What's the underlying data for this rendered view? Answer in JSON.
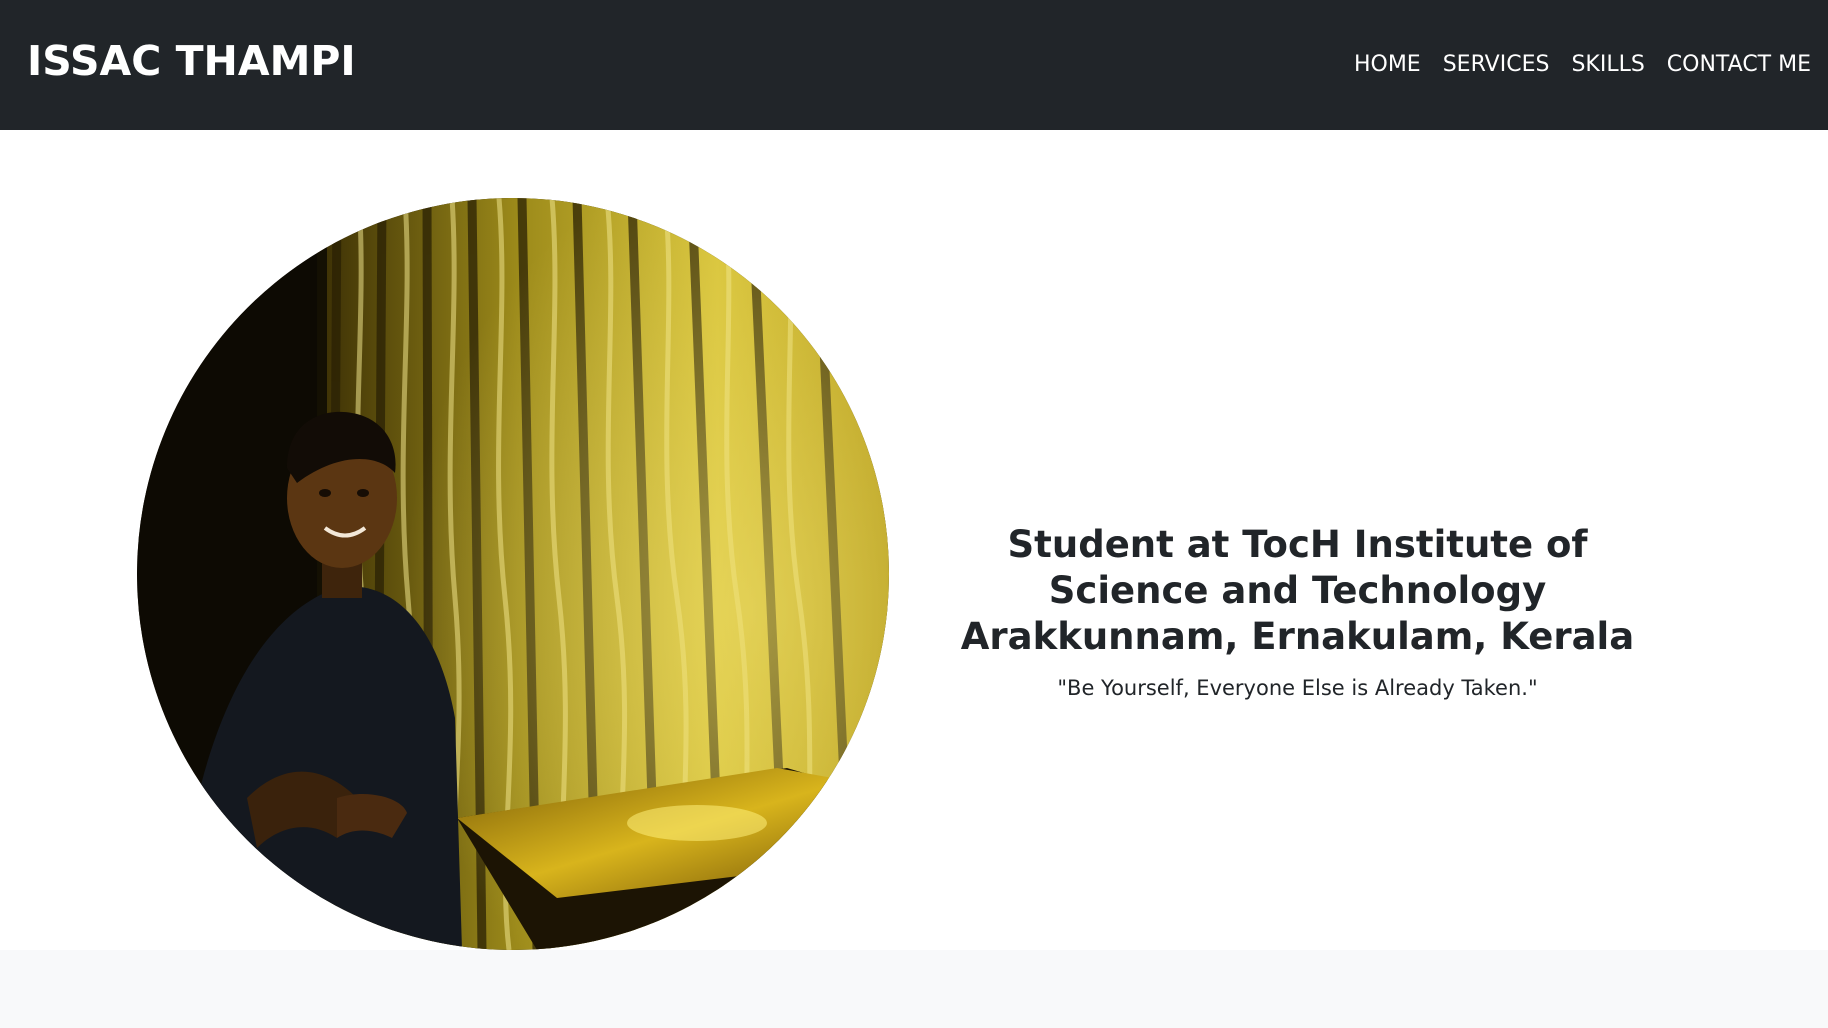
{
  "navbar": {
    "brand": "ISSAC THAMPI",
    "links": [
      "HOME",
      "SERVICES",
      "SKILLS",
      "CONTACT ME"
    ]
  },
  "hero": {
    "photo_icon": "profile-photo",
    "heading_line1": "Student at TocH Institute of Science and Technology",
    "heading_line2": "Arakkunnam, Ernakulam, Kerala",
    "quote": "\"Be Yourself, Everyone Else is Already Taken.\""
  },
  "colors": {
    "navbar_bg": "#212529",
    "nav_text": "#ffffff",
    "page_bg": "#ffffff",
    "footer_bg": "#f8f9fa",
    "text": "#212529"
  }
}
